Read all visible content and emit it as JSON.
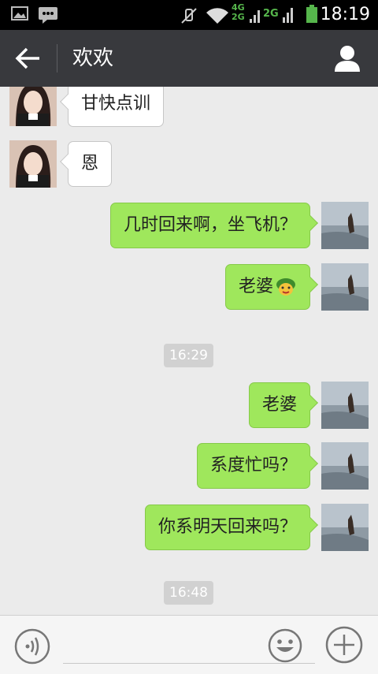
{
  "status_bar": {
    "time": "18:19",
    "network_primary": "4G",
    "network_secondary": "2G",
    "network_third": "2G",
    "icons": [
      "picture-icon",
      "message-icon",
      "mute-icon",
      "wifi-icon",
      "signal-icon",
      "battery-icon"
    ]
  },
  "header": {
    "title": "欢欢",
    "back_icon": "arrow-left-icon",
    "profile_icon": "person-icon"
  },
  "messages": [
    {
      "side": "left",
      "text": "甘快点训"
    },
    {
      "side": "left",
      "text": "恩"
    },
    {
      "side": "right",
      "text": "几时回来啊，坐飞机？"
    },
    {
      "side": "right",
      "text": "老婆",
      "emoji": "turtle-emoji-icon"
    },
    {
      "type": "time",
      "text": "16:29"
    },
    {
      "side": "right",
      "text": "老婆"
    },
    {
      "side": "right",
      "text": "系度忙吗？"
    },
    {
      "side": "right",
      "text": "你系明天回来吗？"
    },
    {
      "type": "time",
      "text": "16:48"
    }
  ],
  "input_bar": {
    "voice_icon": "voice-icon",
    "emoji_icon": "smiley-icon",
    "plus_icon": "plus-icon",
    "input_value": ""
  },
  "colors": {
    "header_bg": "#38393d",
    "chat_bg": "#ebebeb",
    "outgoing_bubble": "#9fe75c",
    "incoming_bubble": "#ffffff"
  }
}
